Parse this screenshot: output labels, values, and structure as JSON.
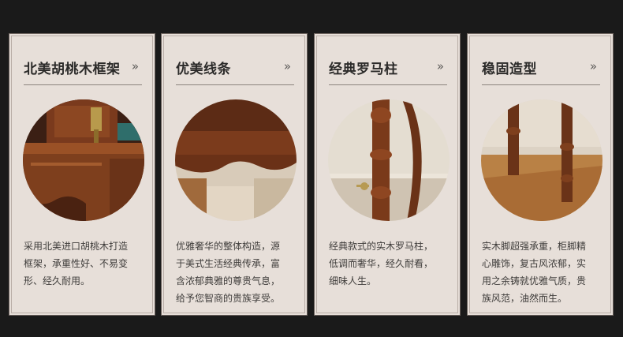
{
  "cards": [
    {
      "title": "北美胡桃木框架",
      "chevron": "»",
      "image": "walnut-frame-detail",
      "desc": [
        "采用北美进口胡桃木打造",
        "框架，承重性好、不易变",
        "形、经久耐用。"
      ]
    },
    {
      "title": "优美线条",
      "chevron": "»",
      "image": "carved-curve-detail",
      "desc": [
        "优雅奢华的整体构造，源",
        "于美式生活经典传承，富",
        "含浓郁典雅的尊贵气息，",
        "给予您智商的贵族享受。"
      ]
    },
    {
      "title": "经典罗马柱",
      "chevron": "»",
      "image": "roman-column-detail",
      "desc": [
        "经典款式的实木罗马柱，",
        "低调而奢华，经久耐看，",
        "细味人生。"
      ]
    },
    {
      "title": "稳固造型",
      "chevron": "»",
      "image": "sturdy-legs-detail",
      "desc": [
        "实木脚超强承重，柜脚精",
        "心雕饰，复古风浓郁，实",
        "用之余铸就优雅气质，贵",
        "族风范，油然而生。"
      ]
    }
  ],
  "colors": {
    "page_bg": "#1a1a1a",
    "card_bg": "#e7dfd9",
    "title": "#2b2a29",
    "text": "#3f3d3b"
  }
}
